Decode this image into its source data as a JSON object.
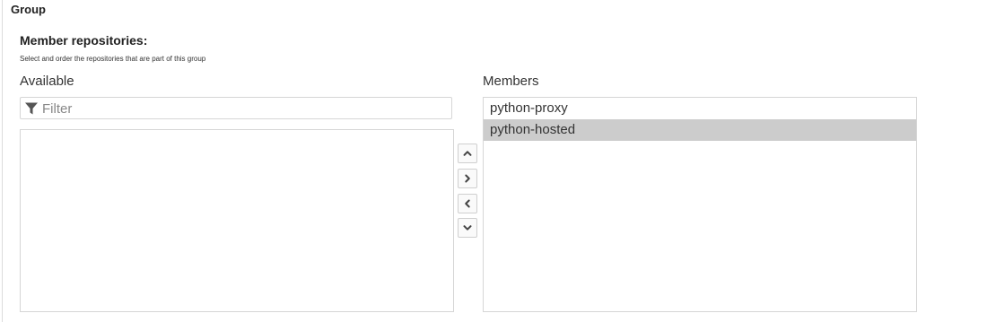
{
  "section": {
    "title": "Group"
  },
  "member_repositories": {
    "label": "Member repositories:",
    "help": "Select and order the repositories that are part of this group",
    "available": {
      "heading": "Available",
      "filter_placeholder": "Filter",
      "filter_value": "",
      "items": []
    },
    "members": {
      "heading": "Members",
      "items": [
        {
          "label": "python-proxy",
          "selected": false
        },
        {
          "label": "python-hosted",
          "selected": true
        }
      ]
    },
    "controls": [
      {
        "action": "move-up",
        "icon": "chevron-up-icon"
      },
      {
        "action": "add",
        "icon": "chevron-right-icon"
      },
      {
        "action": "remove",
        "icon": "chevron-left-icon"
      },
      {
        "action": "move-down",
        "icon": "chevron-down-icon"
      }
    ]
  },
  "colors": {
    "selected_row": "#cccccc",
    "border": "#d6d6d6",
    "text": "#333333"
  }
}
